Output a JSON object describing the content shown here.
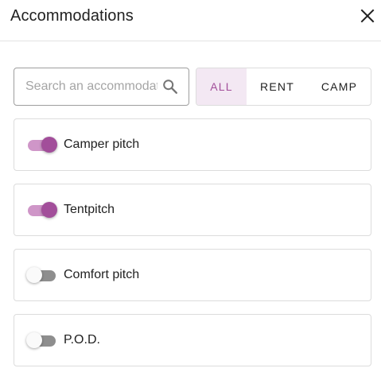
{
  "dialog": {
    "title": "Accommodations"
  },
  "search": {
    "placeholder": "Search an accommodation",
    "value": ""
  },
  "filters": [
    {
      "label": "ALL",
      "selected": true
    },
    {
      "label": "RENT",
      "selected": false
    },
    {
      "label": "CAMP",
      "selected": false
    }
  ],
  "accommodations": [
    {
      "label": "Camper pitch",
      "enabled": true
    },
    {
      "label": "Tentpitch",
      "enabled": true
    },
    {
      "label": "Comfort pitch",
      "enabled": false
    },
    {
      "label": "P.O.D.",
      "enabled": false
    }
  ],
  "colors": {
    "accent": "#a24e9a",
    "accent_light": "#cf96c8",
    "selected_bg": "#f3e8f3",
    "toggle_off": "#8e8e8e"
  },
  "icons": {
    "close": "close-icon",
    "search": "search-icon"
  }
}
